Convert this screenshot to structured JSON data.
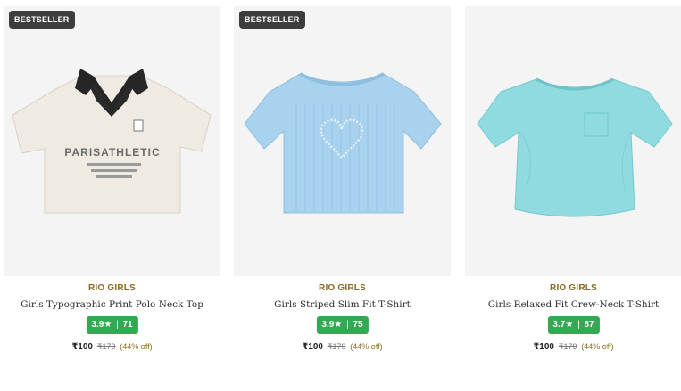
{
  "products": [
    {
      "badge": "BESTSELLER",
      "brand": "RIO GIRLS",
      "name": "Girls Typographic Print Polo Neck Top",
      "rating": "3.9★",
      "reviews": "71",
      "price": "₹100",
      "mrp": "₹179",
      "discount": "(44% off)",
      "color": "#efebe2",
      "image_text": "PARISATHLETIC"
    },
    {
      "badge": "BESTSELLER",
      "brand": "RIO GIRLS",
      "name": "Girls Striped Slim Fit T-Shirt",
      "rating": "3.9★",
      "reviews": "75",
      "price": "₹100",
      "mrp": "₹179",
      "discount": "(44% off)",
      "color": "#a9d2ee"
    },
    {
      "brand": "RIO GIRLS",
      "name": "Girls Relaxed Fit Crew-Neck T-Shirt",
      "rating": "3.7★",
      "reviews": "87",
      "price": "₹100",
      "mrp": "₹179",
      "discount": "(44% off)",
      "color": "#8fdbe0"
    }
  ],
  "rating_separator": "|"
}
